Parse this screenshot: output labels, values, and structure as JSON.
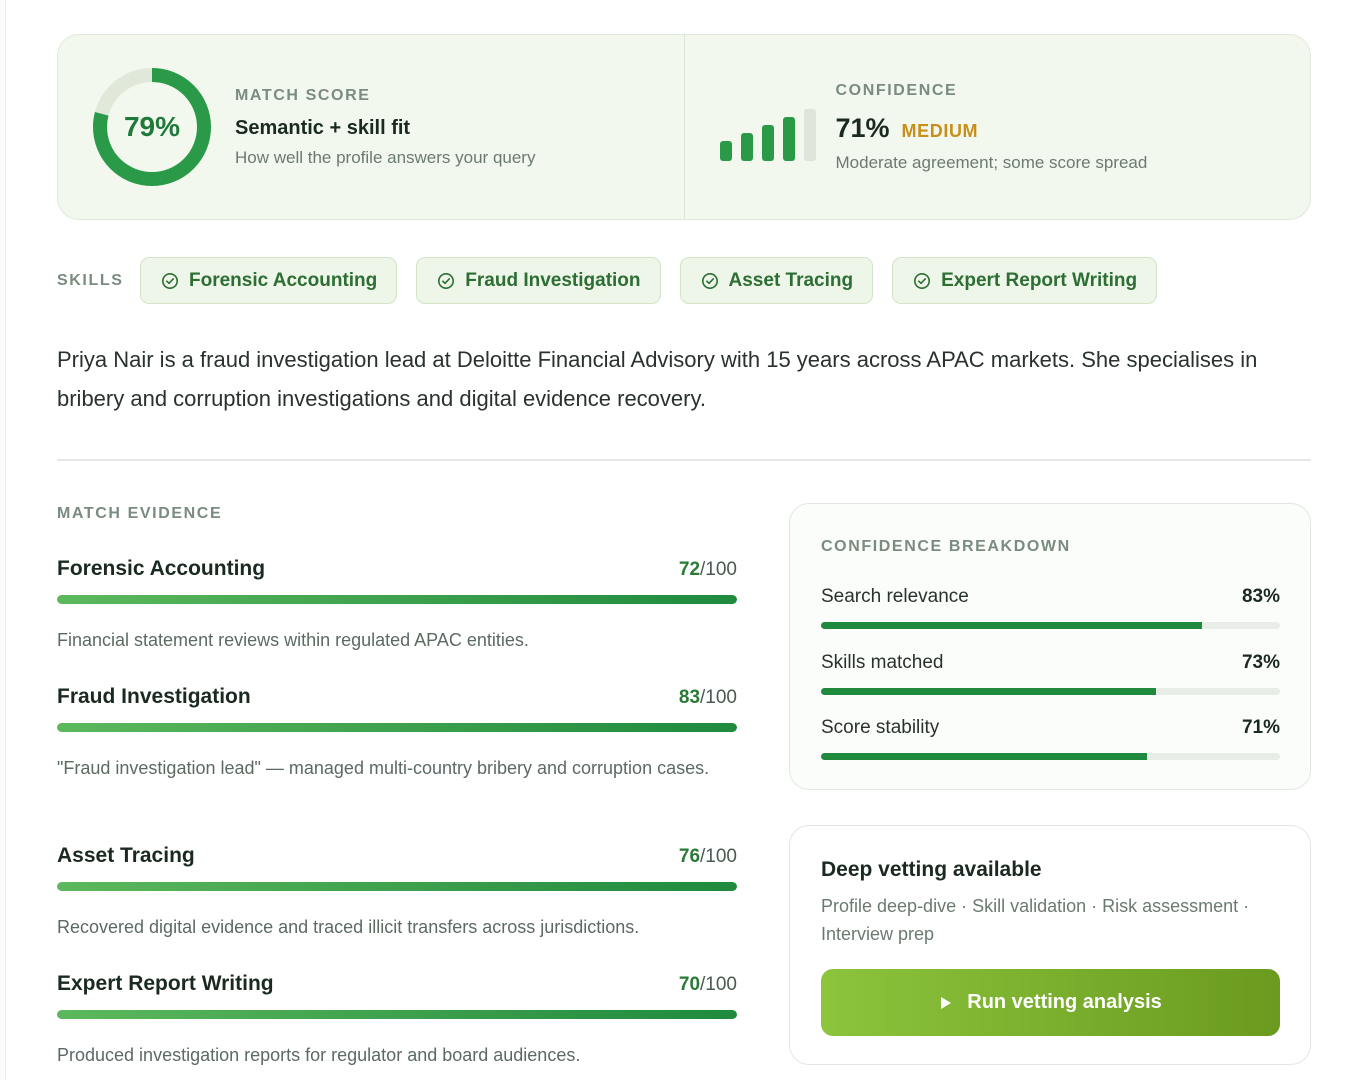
{
  "match_score": {
    "value": "79%",
    "fraction": 0.79,
    "kicker": "MATCH SCORE",
    "title": "Semantic + skill fit",
    "subtitle": "How well the profile answers your query"
  },
  "confidence": {
    "kicker": "CONFIDENCE",
    "value": "71%",
    "level": "MEDIUM",
    "subtitle": "Moderate agreement; some score spread",
    "signal_bars_active": 4,
    "signal_bars_total": 5
  },
  "skills": {
    "label": "SKILLS",
    "items": [
      {
        "label": "Forensic Accounting"
      },
      {
        "label": "Fraud Investigation"
      },
      {
        "label": "Asset Tracing"
      },
      {
        "label": "Expert Report Writing"
      }
    ]
  },
  "bio": "Priya Nair is a fraud investigation lead at Deloitte Financial Advisory with 15 years across APAC markets. She specialises in bribery and corruption investigations and digital evidence recovery.",
  "evidence": {
    "kicker": "MATCH EVIDENCE",
    "suffix": "/100",
    "items": [
      {
        "name": "Forensic Accounting",
        "score": "72",
        "value": 72,
        "desc": "Financial statement reviews within regulated APAC entities."
      },
      {
        "name": "Fraud Investigation",
        "score": "83",
        "value": 83,
        "desc": "\"Fraud investigation lead\" — managed multi-country bribery and corruption cases."
      },
      {
        "name": "Asset Tracing",
        "score": "76",
        "value": 76,
        "desc": "Recovered digital evidence and traced illicit transfers across jurisdictions."
      },
      {
        "name": "Expert Report Writing",
        "score": "70",
        "value": 70,
        "desc": "Produced investigation reports for regulator and board audiences."
      }
    ]
  },
  "breakdown": {
    "kicker": "CONFIDENCE BREAKDOWN",
    "items": [
      {
        "label": "Search relevance",
        "value": "83%",
        "fraction": 0.83
      },
      {
        "label": "Skills matched",
        "value": "73%",
        "fraction": 0.73
      },
      {
        "label": "Score stability",
        "value": "71%",
        "fraction": 0.71
      }
    ]
  },
  "vetting": {
    "title": "Deep vetting available",
    "subtitle": "Profile deep-dive · Skill validation · Risk assessment · Interview prep",
    "button_label": "Run vetting analysis"
  },
  "colors": {
    "accent_green": "#1f8a3e",
    "chip_bg": "#eef6e9",
    "medium_amber": "#c7901a",
    "button_start": "#8cc43c",
    "button_end": "#6a9a1f"
  },
  "icons": {
    "chip": "check-circle-icon",
    "button": "play-icon"
  }
}
